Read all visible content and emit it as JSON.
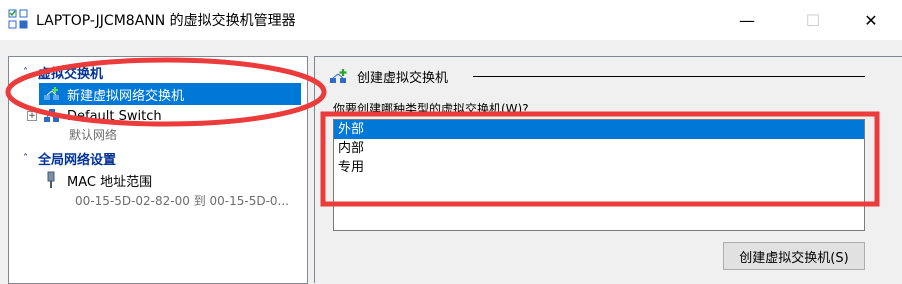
{
  "window": {
    "title": "LAPTOP-JJCM8ANN 的虚拟交换机管理器",
    "minimize": "—",
    "maximize": "☐",
    "close": "✕"
  },
  "tree": {
    "section_vswitch": "虚拟交换机",
    "new_vswitch": "新建虚拟网络交换机",
    "default_switch": "Default Switch",
    "default_switch_sub": "默认网络",
    "section_global": "全局网络设置",
    "mac_range": "MAC 地址范围",
    "mac_range_sub": "00-15-5D-02-82-00 到 00-15-5D-0..."
  },
  "panel": {
    "title": "创建虚拟交换机",
    "question": "你要创建哪种类型的虚拟交换机(W)?",
    "options": [
      "外部",
      "内部",
      "专用"
    ],
    "selected_option": "外部",
    "create_button": "创建虚拟交换机(S)"
  },
  "colors": {
    "selection": "#0078d7",
    "section_header": "#003399",
    "annotation": "#ec3b3b"
  }
}
